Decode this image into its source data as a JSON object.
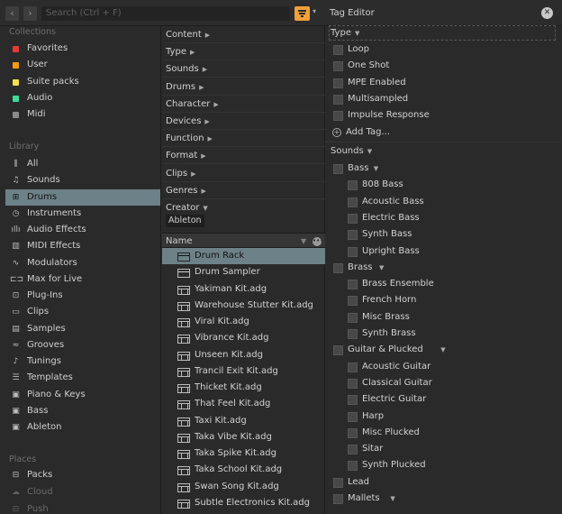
{
  "search": {
    "placeholder": "Search (Ctrl + F)"
  },
  "nav": {
    "back": "‹",
    "forward": "›"
  },
  "sidebar": {
    "collections_heading": "Collections",
    "collections": [
      {
        "label": "Favorites",
        "color": "#e53935"
      },
      {
        "label": "User",
        "color": "#f39c12"
      },
      {
        "label": "Suite packs",
        "color": "#f4e04d"
      },
      {
        "label": "Audio",
        "color": "#3ddc97"
      },
      {
        "label": "Midi",
        "color": "#8a8a8a"
      }
    ],
    "library_heading": "Library",
    "library": [
      {
        "label": "All",
        "icon": "library-all-icon",
        "glyph": "⫼"
      },
      {
        "label": "Sounds",
        "icon": "sounds-note-icon",
        "glyph": "♫"
      },
      {
        "label": "Drums",
        "icon": "drums-grid-icon",
        "glyph": "⊞"
      },
      {
        "label": "Instruments",
        "icon": "instrument-clock-icon",
        "glyph": "◷"
      },
      {
        "label": "Audio Effects",
        "icon": "audio-effects-waveform-icon",
        "glyph": "ıllı"
      },
      {
        "label": "MIDI Effects",
        "icon": "midi-effects-keyboard-icon",
        "glyph": "▥"
      },
      {
        "label": "Modulators",
        "icon": "modulators-wave-icon",
        "glyph": "∿"
      },
      {
        "label": "Max for Live",
        "icon": "max-for-live-icon",
        "glyph": "⊏⊐"
      },
      {
        "label": "Plug-Ins",
        "icon": "plugin-icon",
        "glyph": "⊡"
      },
      {
        "label": "Clips",
        "icon": "clips-icon",
        "glyph": "▭"
      },
      {
        "label": "Samples",
        "icon": "samples-waveform-icon",
        "glyph": "▤"
      },
      {
        "label": "Grooves",
        "icon": "grooves-icon",
        "glyph": "≈"
      },
      {
        "label": "Tunings",
        "icon": "tunings-icon",
        "glyph": "♪"
      },
      {
        "label": "Templates",
        "icon": "templates-icon",
        "glyph": "☰"
      },
      {
        "label": "Piano & Keys",
        "icon": "folder-icon",
        "glyph": "▣"
      },
      {
        "label": "Bass",
        "icon": "folder-icon",
        "glyph": "▣"
      },
      {
        "label": "Ableton",
        "icon": "folder-icon",
        "glyph": "▣"
      }
    ],
    "places_heading": "Places",
    "places": [
      {
        "label": "Packs",
        "icon": "packs-icon",
        "glyph": "⊟"
      },
      {
        "label": "Cloud",
        "icon": "cloud-icon",
        "glyph": "☁"
      },
      {
        "label": "Push",
        "icon": "push-icon",
        "glyph": "⊟"
      }
    ]
  },
  "filters": {
    "rows": [
      "Content",
      "Type",
      "Sounds",
      "Drums",
      "Character",
      "Devices",
      "Function",
      "Format",
      "Clips",
      "Genres",
      "Creator"
    ],
    "creator_chip": "Ableton"
  },
  "files": {
    "column_header": "Name",
    "items": [
      {
        "name": "Drum Rack",
        "kind": "rack"
      },
      {
        "name": "Drum Sampler",
        "kind": "rack"
      },
      {
        "name": "Yakiman Kit.adg",
        "kind": "kit"
      },
      {
        "name": "Warehouse Stutter Kit.adg",
        "kind": "kit"
      },
      {
        "name": "Viral Kit.adg",
        "kind": "kit"
      },
      {
        "name": "Vibrance Kit.adg",
        "kind": "kit"
      },
      {
        "name": "Unseen Kit.adg",
        "kind": "kit"
      },
      {
        "name": "Trancil Exit Kit.adg",
        "kind": "kit"
      },
      {
        "name": "Thicket Kit.adg",
        "kind": "kit"
      },
      {
        "name": "That Feel Kit.adg",
        "kind": "kit"
      },
      {
        "name": "Taxi Kit.adg",
        "kind": "kit"
      },
      {
        "name": "Taka Vibe Kit.adg",
        "kind": "kit"
      },
      {
        "name": "Taka Spike Kit.adg",
        "kind": "kit"
      },
      {
        "name": "Taka School Kit.adg",
        "kind": "kit"
      },
      {
        "name": "Swan Song Kit.adg",
        "kind": "kit"
      },
      {
        "name": "Subtle Electronics Kit.adg",
        "kind": "kit"
      }
    ]
  },
  "tag_editor": {
    "title": "Tag Editor",
    "type_heading": "Type",
    "type_tags": [
      "Loop",
      "One Shot",
      "MPE Enabled",
      "Multisampled",
      "Impulse Response"
    ],
    "add_tag": "Add Tag...",
    "sounds_heading": "Sounds",
    "groups": [
      {
        "name": "Bass",
        "children": [
          "808 Bass",
          "Acoustic Bass",
          "Electric Bass",
          "Synth Bass",
          "Upright Bass"
        ]
      },
      {
        "name": "Brass",
        "children": [
          "Brass Ensemble",
          "French Horn",
          "Misc Brass",
          "Synth Brass"
        ]
      },
      {
        "name": "Guitar & Plucked",
        "children": [
          "Acoustic Guitar",
          "Classical Guitar",
          "Electric Guitar",
          "Harp",
          "Misc Plucked",
          "Sitar",
          "Synth Plucked"
        ]
      },
      {
        "name": "Lead",
        "children": []
      },
      {
        "name": "Mallets",
        "children": []
      }
    ]
  }
}
